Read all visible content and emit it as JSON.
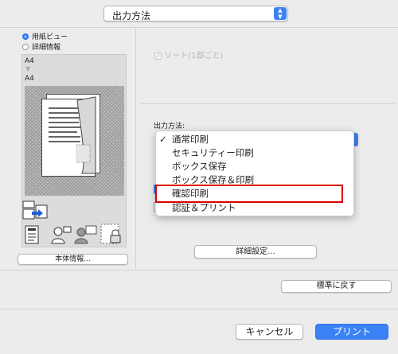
{
  "output_select": {
    "selected": "出力方法"
  },
  "preview": {
    "view_options": [
      "用紙ビュー",
      "詳細情報"
    ],
    "paper_from": "A4",
    "paper_arrow": "▼",
    "paper_to": "A4",
    "device_info_button": "本体情報..."
  },
  "sort": {
    "label": "ソート(1部ごと)",
    "checked": true,
    "enabled": false
  },
  "output_method": {
    "label": "出力方法:",
    "options": [
      "通常印刷",
      "セキュリティー印刷",
      "ボックス保存",
      "ボックス保存＆印刷",
      "確認印刷",
      "認証＆プリント"
    ],
    "checked_option": "通常印刷",
    "check_mark": "✓",
    "highlighted_option": "確認印刷"
  },
  "detail_settings_button": "詳細設定...",
  "reset_button": "標準に戻す",
  "footer": {
    "cancel": "キャンセル",
    "print": "プリント"
  },
  "colors": {
    "accent": "#3b82f6",
    "highlight": "#e00000"
  }
}
